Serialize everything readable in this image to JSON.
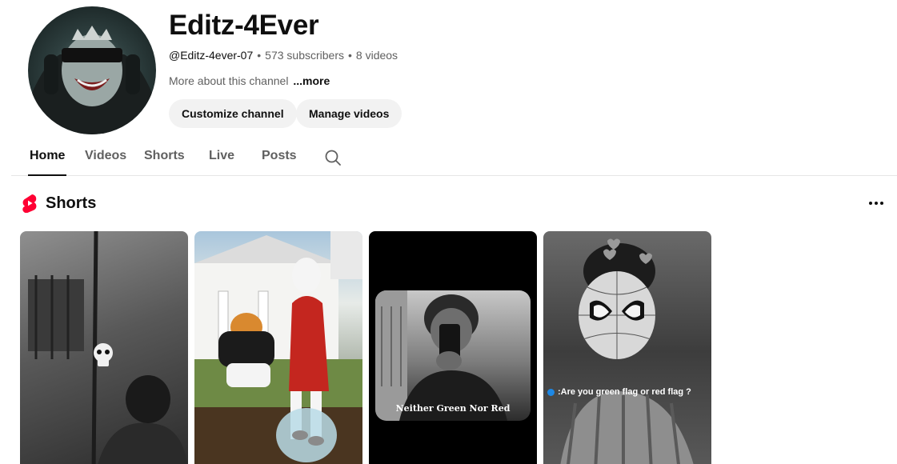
{
  "channel": {
    "name": "Editz-4Ever",
    "handle": "@Editz-4ever-07",
    "subscribers": "573 subscribers",
    "videos": "8 videos",
    "separator": "•",
    "about_text": "More about this channel",
    "about_more": "...more"
  },
  "actions": {
    "customize_label": "Customize channel",
    "manage_label": "Manage videos"
  },
  "tabs": [
    {
      "label": "Home",
      "active": true
    },
    {
      "label": "Videos",
      "active": false
    },
    {
      "label": "Shorts",
      "active": false
    },
    {
      "label": "Live",
      "active": false
    },
    {
      "label": "Posts",
      "active": false
    }
  ],
  "shorts_section": {
    "title": "Shorts",
    "items": [
      {
        "thumbnail": "grayscale skull emoji clip",
        "caption": ""
      },
      {
        "thumbnail": "cats in garden digging",
        "caption": ""
      },
      {
        "thumbnail": "mirror selfie frame",
        "caption": "Neither Green Nor Red"
      },
      {
        "thumbnail": "spider-man mask portrait",
        "caption": ":Are you green flag or red flag ?"
      }
    ]
  },
  "icons": {
    "search": "search-icon",
    "shorts_logo": "shorts-logo-icon",
    "more": "more-vert-icon"
  },
  "colors": {
    "shorts_red": "#ff0033",
    "pill_bg": "#f2f2f2",
    "muted_text": "#606060"
  }
}
